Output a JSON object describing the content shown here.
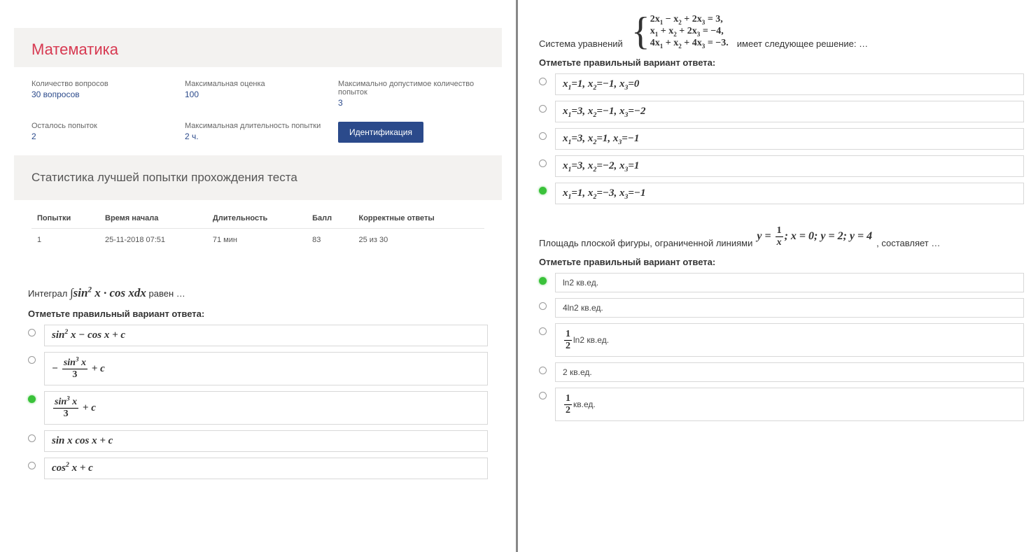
{
  "left": {
    "title": "Математика",
    "info": {
      "r1c1_label": "Количество вопросов",
      "r1c1_value": "30 вопросов",
      "r1c2_label": "Максимальная оценка",
      "r1c2_value": "100",
      "r1c3_label": "Максимально допустимое количество попыток",
      "r1c3_value": "3",
      "r2c1_label": "Осталось попыток",
      "r2c1_value": "2",
      "r2c2_label": "Максимальная длительность попытки",
      "r2c2_value": "2 ч.",
      "btn": "Идентификация"
    },
    "stats_title": "Статистика лучшей попытки прохождения теста",
    "table": {
      "h1": "Попытки",
      "h2": "Время начала",
      "h3": "Длительность",
      "h4": "Балл",
      "h5": "Корректные ответы",
      "c1": "1",
      "c2": "25-11-2018 07:51",
      "c3": "71 мин",
      "c4": "83",
      "c5": "25 из 30"
    },
    "q1": {
      "pre": "Интеграл ",
      "post": " равен …",
      "instr": "Отметьте правильный вариант ответа:"
    }
  },
  "right": {
    "q2": {
      "pre": "Система уравнений ",
      "post": "имеет следующее решение: …",
      "instr": "Отметьте правильный вариант ответа:"
    },
    "q3": {
      "pre": "Площадь плоской фигуры, ограниченной линиями ",
      "post": " , составляет …",
      "instr": "Отметьте правильный вариант ответа:",
      "o1": "ln2 кв.ед.",
      "o2": "4ln2 кв.ед.",
      "o3tail": " ln2 кв.ед.",
      "o4": "2 кв.ед.",
      "o5tail": " кв.ед."
    }
  }
}
